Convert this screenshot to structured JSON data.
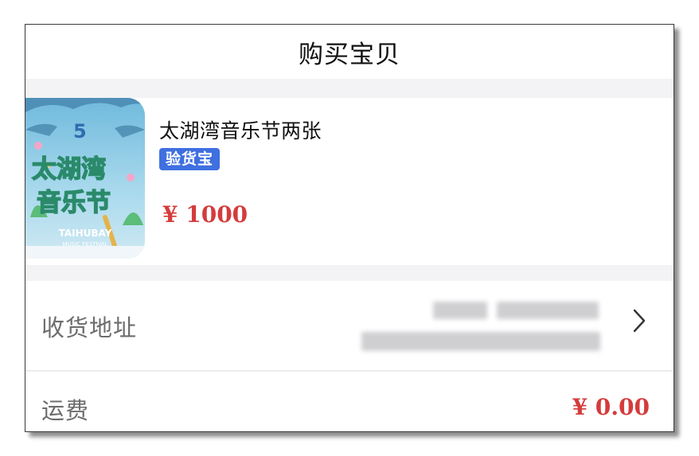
{
  "header": {
    "title": "购买宝贝"
  },
  "product": {
    "name": "太湖湾音乐节两张",
    "badge": "验货宝",
    "price": "¥ 1000",
    "image": {
      "festival_name_line1": "太湖湾",
      "festival_name_line2": "音乐节",
      "english_line1": "TAIHUBAY",
      "english_line2": "MUSIC FESTIVAL",
      "edition": "5"
    }
  },
  "address": {
    "label": "收货地址"
  },
  "shipping": {
    "label": "运费",
    "value": "¥ 0.00"
  },
  "colors": {
    "price_red": "#d43c3c",
    "badge_blue": "#3f6fe0",
    "label_gray": "#6d6d6d"
  },
  "icons": {
    "address_chevron": "chevron-right-icon"
  }
}
